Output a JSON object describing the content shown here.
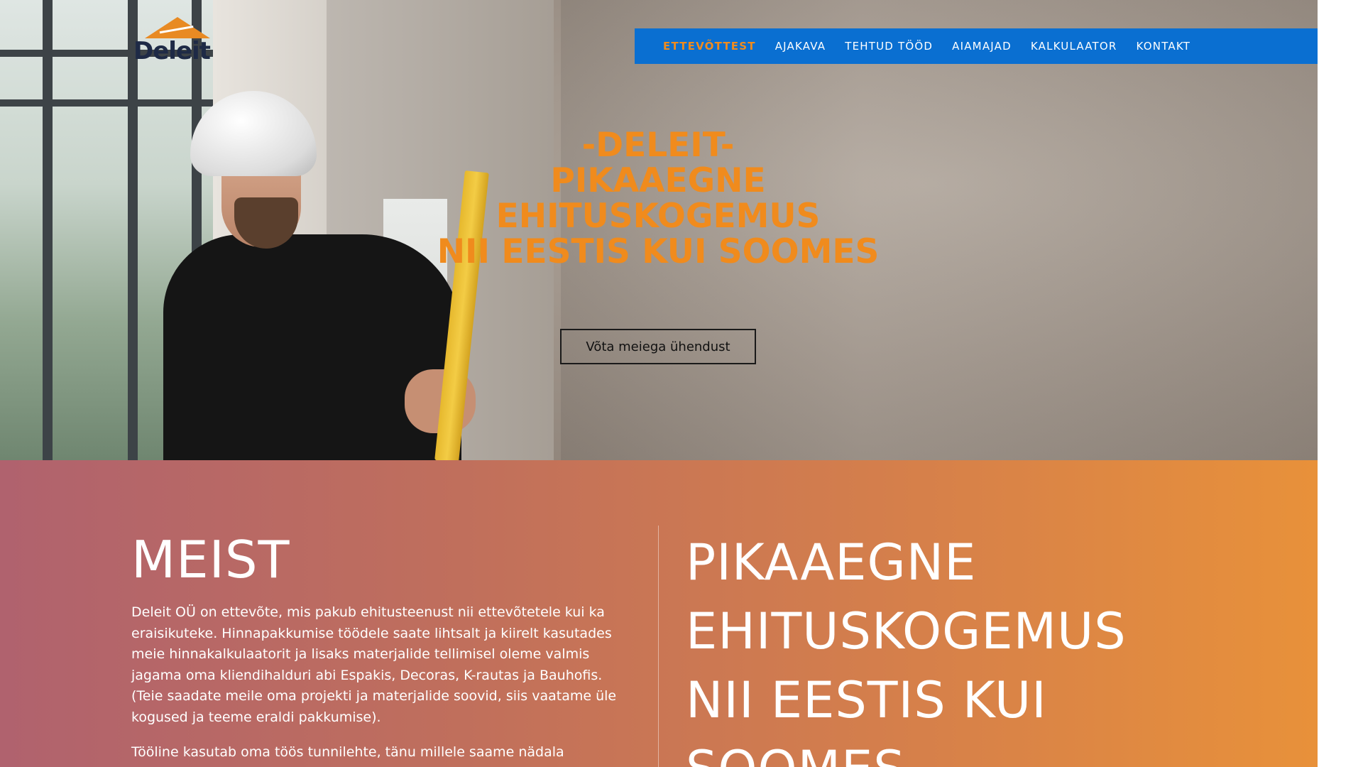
{
  "brand": {
    "logo_text": "Deleit"
  },
  "nav": {
    "items": [
      {
        "label": "ETTEVÕTTEST",
        "active": true
      },
      {
        "label": "AJAKAVA",
        "active": false
      },
      {
        "label": "TEHTUD TÖÖD",
        "active": false
      },
      {
        "label": "AIAMAJAD",
        "active": false
      },
      {
        "label": "KALKULAATOR",
        "active": false
      },
      {
        "label": "KONTAKT",
        "active": false
      }
    ]
  },
  "hero": {
    "heading_lines": [
      "-DELEIT-",
      "PIKAAEGNE",
      "EHITUSKOGEMUS",
      "NII EESTIS KUI SOOMES"
    ],
    "cta_label": "Võta meiega ühendust"
  },
  "about": {
    "title": "MEIST",
    "paragraphs": [
      "Deleit OÜ on ettevõte, mis pakub ehitusteenust nii ettevõtetele kui ka eraisikuteke. Hinnapakkumise töödele saate lihtsalt ja kiirelt kasutades meie hinnakalkulaatorit ja lisaks materjalide tellimisel oleme valmis jagama oma kliendihalduri abi Espakis, Decoras, K-rautas ja Bauhofis.(Teie saadate meile oma projekti ja materjalide soovid, siis vaatame üle kogused ja teeme eraldi pakkumise).",
      "Tööline kasutab oma töös tunnilehte, tänu millele saame nädala"
    ],
    "tagline_lines": [
      "PIKAAEGNE",
      "EHITUSKOGEMUS",
      "NII EESTIS KUI",
      "SOOMES"
    ]
  },
  "colors": {
    "nav_bg": "#0a6fd1",
    "accent_orange": "#f08b1d",
    "gradient_start": "#b0626e",
    "gradient_end": "#e8913a"
  }
}
